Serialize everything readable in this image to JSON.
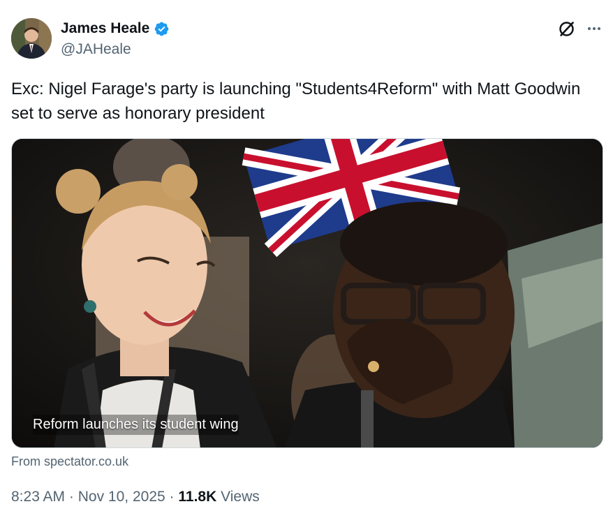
{
  "author": {
    "name": "James Heale",
    "handle": "@JAHeale",
    "verified": true,
    "verified_color": "#1d9bf0"
  },
  "tweet": {
    "text": "Exc: Nigel Farage's party is launching \"Students4Reform\" with Matt Goodwin set to serve as honorary president"
  },
  "media": {
    "caption": "Reform launches its student wing",
    "source": "From spectator.co.uk"
  },
  "meta": {
    "time": "8:23 AM",
    "separator": "·",
    "date": "Nov 10, 2025",
    "views_count": "11.8K",
    "views_label": "Views"
  },
  "icons": {
    "grok": "grok-icon",
    "more": "more-icon",
    "verified": "verified-badge-icon"
  },
  "colors": {
    "text_primary": "#0f1419",
    "text_secondary": "#536471",
    "border": "#cfd9de"
  }
}
